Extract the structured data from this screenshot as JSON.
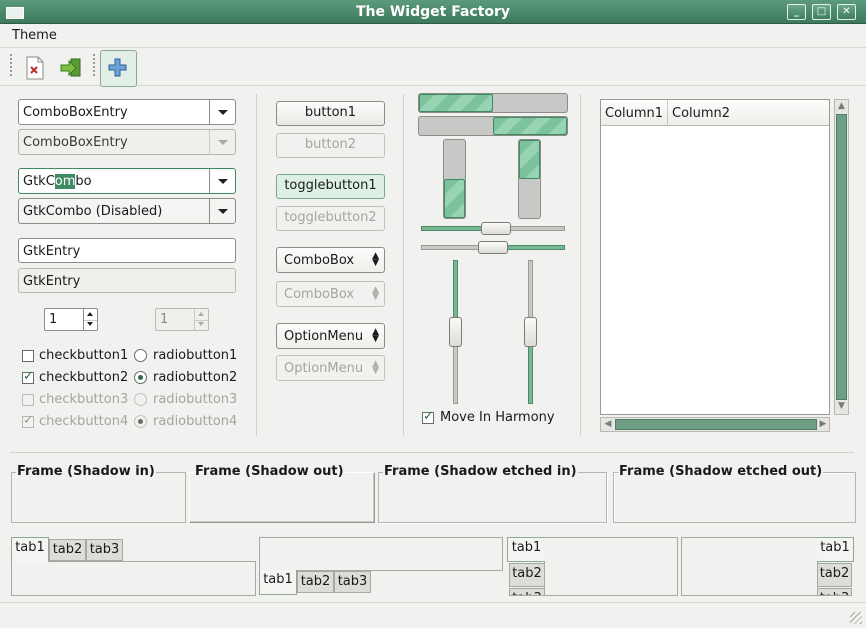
{
  "window": {
    "title": "The Widget Factory",
    "btn_min": "_",
    "btn_max": "□",
    "btn_close": "✕"
  },
  "menubar": {
    "theme": "Theme"
  },
  "toolbar": {
    "items": [
      "document-close-icon",
      "quit-icon",
      "add-icon"
    ]
  },
  "col1": {
    "combo_entry_1": "ComboBoxEntry",
    "combo_entry_2": "ComboBoxEntry",
    "gtkcombo_pre": "GtkC",
    "gtkcombo_sel": "om",
    "gtkcombo_post": "bo",
    "gtkcombo_disabled": "GtkCombo (Disabled)",
    "entry_1": "GtkEntry",
    "entry_2": "GtkEntry",
    "spin_1": "1",
    "spin_2": "1",
    "checks": [
      {
        "label": "checkbutton1",
        "checked": false,
        "disabled": false
      },
      {
        "label": "checkbutton2",
        "checked": true,
        "disabled": false
      },
      {
        "label": "checkbutton3",
        "checked": false,
        "disabled": true
      },
      {
        "label": "checkbutton4",
        "checked": true,
        "disabled": true
      }
    ],
    "radios": [
      {
        "label": "radiobutton1",
        "checked": false,
        "disabled": false
      },
      {
        "label": "radiobutton2",
        "checked": true,
        "disabled": false
      },
      {
        "label": "radiobutton3",
        "checked": false,
        "disabled": true
      },
      {
        "label": "radiobutton4",
        "checked": true,
        "disabled": true
      }
    ]
  },
  "col2": {
    "button1": "button1",
    "button2": "button2",
    "toggle1": "togglebutton1",
    "toggle2": "togglebutton2",
    "combobox1": "ComboBox",
    "combobox2": "ComboBox",
    "option1": "OptionMenu",
    "option2": "OptionMenu",
    "updown": "▲\n▼"
  },
  "col3": {
    "progress_h1": 0.5,
    "progress_h2": 0.5,
    "progress_v1": 0.5,
    "progress_v2": 0.5,
    "harmony_label": "Move In Harmony",
    "harmony_checked": true
  },
  "tree": {
    "columns": [
      "Column1",
      "Column2"
    ]
  },
  "frames": [
    "Frame (Shadow in)",
    "Frame (Shadow out)",
    "Frame (Shadow etched in)",
    "Frame (Shadow etched out)"
  ],
  "notebooks": {
    "tabs": [
      "tab1",
      "tab2",
      "tab3"
    ]
  },
  "colors": {
    "accent": "#3d8a63",
    "titlebar": "#4a8a6a",
    "background": "#f1f1ef"
  }
}
